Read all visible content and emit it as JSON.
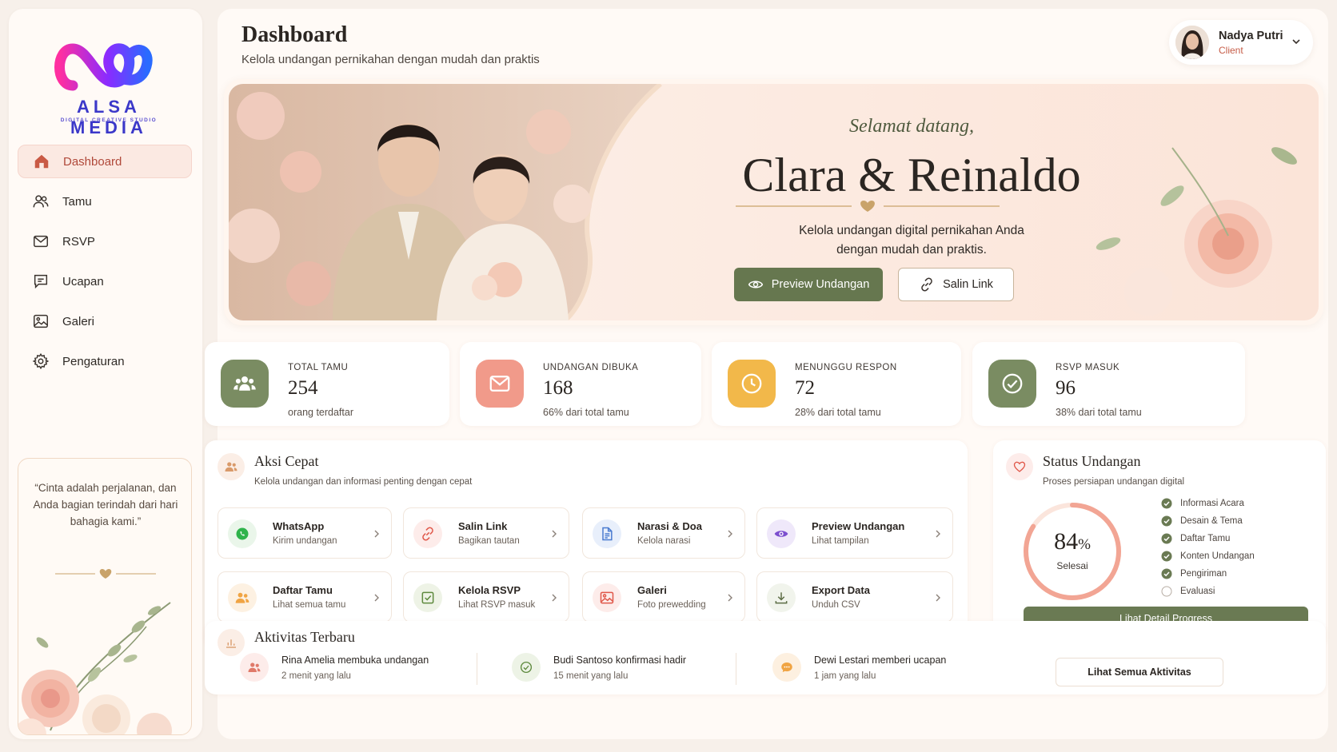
{
  "brand": {
    "name": "ALSA MEDIA",
    "tagline": "DIGITAL CREATIVE STUDIO",
    "colors": [
      "#ff2fa0",
      "#7a2bff",
      "#2a5bff"
    ]
  },
  "sidebar": {
    "items": [
      {
        "label": "Dashboard",
        "icon": "home-icon",
        "active": true
      },
      {
        "label": "Tamu",
        "icon": "users-icon"
      },
      {
        "label": "RSVP",
        "icon": "mail-icon"
      },
      {
        "label": "Ucapan",
        "icon": "message-icon"
      },
      {
        "label": "Galeri",
        "icon": "image-icon"
      },
      {
        "label": "Pengaturan",
        "icon": "gear-icon"
      }
    ],
    "quote": "“Cinta adalah perjalanan, dan Anda bagian terindah dari hari bahagia kami.”"
  },
  "header": {
    "title": "Dashboard",
    "subtitle": "Kelola undangan pernikahan dengan mudah dan praktis",
    "user": {
      "name": "Nadya Putri",
      "role": "Client"
    }
  },
  "hero": {
    "welcome": "Selamat datang,",
    "names": "Clara & Reinaldo",
    "desc_line1": "Kelola undangan digital pernikahan Anda",
    "desc_line2": "dengan mudah dan praktis.",
    "preview_label": "Preview Undangan",
    "copy_label": "Salin Link"
  },
  "stats": [
    {
      "label": "TOTAL TAMU",
      "value": "254",
      "sub": "orang terdaftar",
      "color": "#7a8c62"
    },
    {
      "label": "UNDANGAN DIBUKA",
      "value": "168",
      "sub": "66% dari total tamu",
      "color": "#f19a8a"
    },
    {
      "label": "MENUNGGU RESPON",
      "value": "72",
      "sub": "28% dari total tamu",
      "color": "#f2b84a"
    },
    {
      "label": "RSVP MASUK",
      "value": "96",
      "sub": "38% dari total tamu",
      "color": "#7a8c62"
    }
  ],
  "quick": {
    "title": "Aksi Cepat",
    "subtitle": "Kelola undangan dan informasi penting dengan cepat",
    "items": [
      {
        "title": "WhatsApp",
        "sub": "Kirim undangan",
        "icon": "whatsapp-icon"
      },
      {
        "title": "Salin Link",
        "sub": "Bagikan tautan",
        "icon": "link-icon"
      },
      {
        "title": "Narasi & Doa",
        "sub": "Kelola narasi",
        "icon": "document-icon"
      },
      {
        "title": "Preview Undangan",
        "sub": "Lihat tampilan",
        "icon": "eye-icon"
      },
      {
        "title": "Daftar Tamu",
        "sub": "Lihat semua tamu",
        "icon": "users-icon"
      },
      {
        "title": "Kelola RSVP",
        "sub": "Lihat RSVP masuk",
        "icon": "checkbox-icon"
      },
      {
        "title": "Galeri",
        "sub": "Foto prewedding",
        "icon": "image-icon"
      },
      {
        "title": "Export Data",
        "sub": "Unduh CSV",
        "icon": "download-icon"
      }
    ]
  },
  "status": {
    "title": "Status Undangan",
    "subtitle": "Proses persiapan undangan digital",
    "percent": 84,
    "percent_text": "84",
    "percent_sign": "%",
    "percent_label": "Selesai",
    "checklist": [
      {
        "label": "Informasi Acara",
        "done": true
      },
      {
        "label": "Desain & Tema",
        "done": true
      },
      {
        "label": "Daftar Tamu",
        "done": true
      },
      {
        "label": "Konten Undangan",
        "done": true
      },
      {
        "label": "Pengiriman",
        "done": true
      },
      {
        "label": "Evaluasi",
        "done": false
      }
    ],
    "button": "Lihat Detail Progress"
  },
  "activity": {
    "title": "Aktivitas Terbaru",
    "items": [
      {
        "name": "Rina Amelia",
        "action": "membuka undangan",
        "time": "2 menit yang lalu",
        "icon": "users-icon"
      },
      {
        "name": "Budi Santoso",
        "action": "konfirmasi hadir",
        "time": "15 menit yang lalu",
        "icon": "check-circle-icon"
      },
      {
        "name": "Dewi Lestari",
        "action": "memberi ucapan",
        "time": "1 jam yang lalu",
        "icon": "chat-icon"
      }
    ],
    "button": "Lihat Semua Aktivitas"
  }
}
